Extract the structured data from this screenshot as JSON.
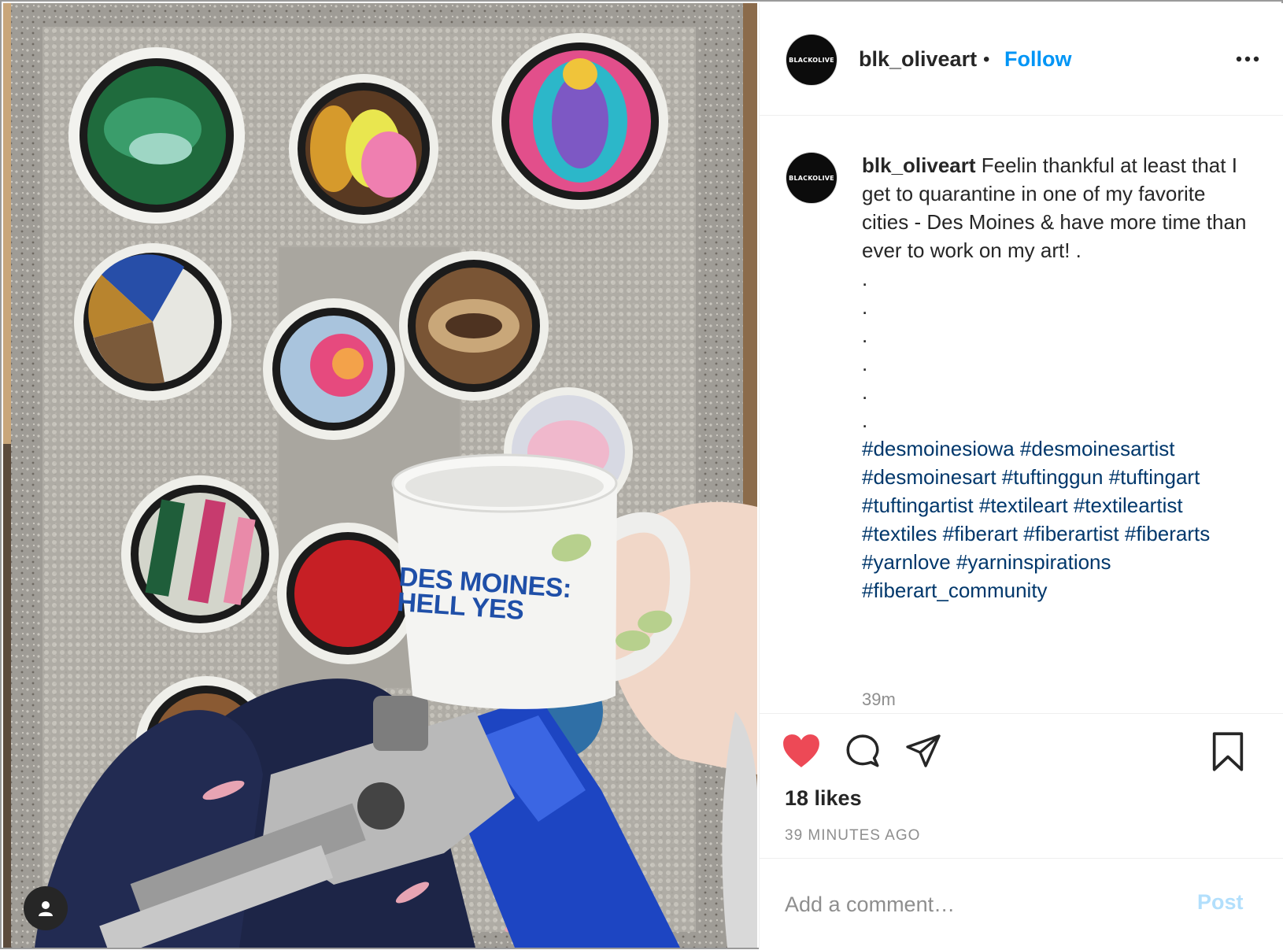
{
  "post": {
    "author": "blk_oliveart",
    "avatar_text": "BLACKOLIVE",
    "follow_label": "Follow",
    "separator": "•",
    "more_icon": "more-horizontal-icon",
    "mug_text_line1": "DES MOINES:",
    "mug_text_line2": "HELL YES"
  },
  "caption": {
    "username": "blk_oliveart",
    "text": "Feelin thankful at least that I get to quarantine in one of my favorite cities - Des Moines & have more time than ever to work on my art! .",
    "dots": [
      ".",
      ".",
      ".",
      ".",
      ".",
      "."
    ],
    "hashtags": [
      "#desmoinesiowa",
      "#desmoinesartist",
      "#desmoinesart",
      "#tuftinggun",
      "#tuftingart",
      "#tuftingartist",
      "#textileart",
      "#textileartist",
      "#textiles",
      "#fiberart",
      "#fiberartist",
      "#fiberarts",
      "#yarnlove",
      "#yarninspirations",
      "#fiberart_community"
    ],
    "time": "39m"
  },
  "actions": {
    "icons": [
      "heart-filled-icon",
      "comment-icon",
      "share-icon",
      "bookmark-icon"
    ],
    "like_color": "#ed4956",
    "likes": "18 likes",
    "ago": "39 MINUTES AGO"
  },
  "comment": {
    "placeholder": "Add a comment…",
    "post_label": "Post"
  }
}
